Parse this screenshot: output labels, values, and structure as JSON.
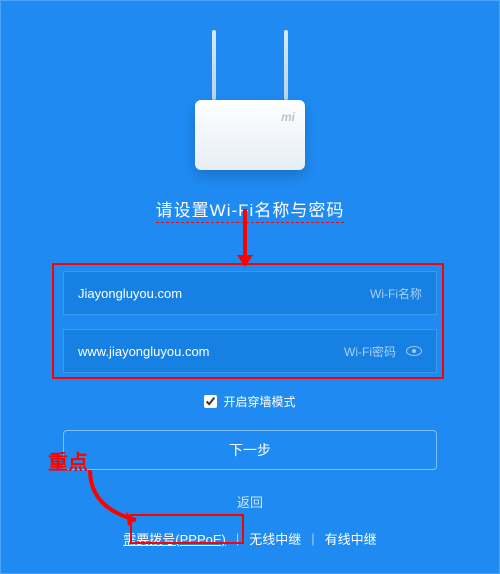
{
  "title": "请设置Wi-Fi名称与密码",
  "form": {
    "wifi_name_value": "Jiayongluyou.com",
    "wifi_name_label": "Wi-Fi名称",
    "wifi_pwd_value": "www.jiayongluyou.com",
    "wifi_pwd_label": "Wi-Fi密码"
  },
  "checkbox_label": "开启穿墙模式",
  "next_btn": "下一步",
  "back_link": "返回",
  "bottom": {
    "pppoe": "需要拨号(PPPoE)",
    "wireless_relay": "无线中继",
    "wired_relay": "有线中继"
  },
  "annotation": {
    "key_label": "重点"
  }
}
